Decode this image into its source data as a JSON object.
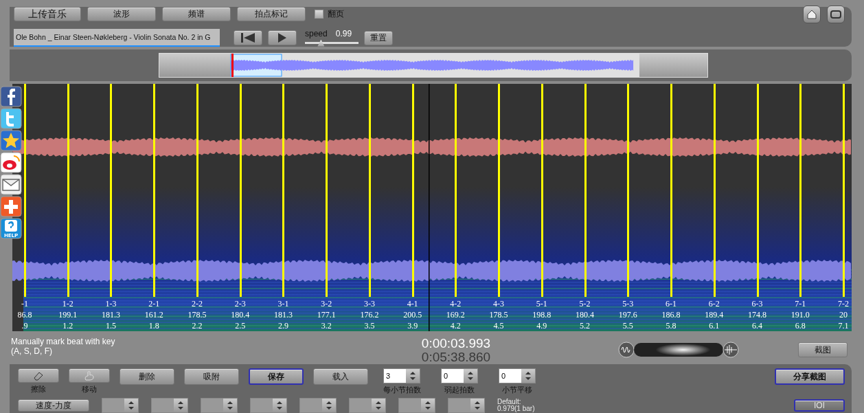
{
  "toolbar": {
    "upload_button": "上传音乐",
    "view_buttons": [
      "波形",
      "频谱",
      "拍点标记"
    ],
    "page_flip": {
      "label": "翻页",
      "checked": false
    }
  },
  "file_name": "Ole Bohn _ Einar Steen-Nøkleberg - Violin Sonata No. 2 in G",
  "speed": {
    "label": "speed",
    "value": "0.99",
    "level": 0.3
  },
  "reset_button": "重置",
  "social": [
    {
      "kind": "facebook"
    },
    {
      "kind": "twitter"
    },
    {
      "kind": "star"
    },
    {
      "kind": "weibo"
    },
    {
      "kind": "mail"
    },
    {
      "kind": "plus"
    },
    {
      "kind": "help",
      "label": "HELP"
    }
  ],
  "beats": [
    {
      "label": "-1",
      "tempo": "86.8",
      "time": ".9"
    },
    {
      "label": "1-2",
      "tempo": "199.1",
      "time": "1.2"
    },
    {
      "label": "1-3",
      "tempo": "181.3",
      "time": "1.5"
    },
    {
      "label": "2-1",
      "tempo": "161.2",
      "time": "1.8"
    },
    {
      "label": "2-2",
      "tempo": "178.5",
      "time": "2.2"
    },
    {
      "label": "2-3",
      "tempo": "180.4",
      "time": "2.5"
    },
    {
      "label": "3-1",
      "tempo": "181.3",
      "time": "2.9"
    },
    {
      "label": "3-2",
      "tempo": "177.1",
      "time": "3.2"
    },
    {
      "label": "3-3",
      "tempo": "176.2",
      "time": "3.5"
    },
    {
      "label": "4-1",
      "tempo": "200.5",
      "time": "3.9"
    },
    {
      "label": "4-2",
      "tempo": "169.2",
      "time": "4.2"
    },
    {
      "label": "4-3",
      "tempo": "178.5",
      "time": "4.5"
    },
    {
      "label": "5-1",
      "tempo": "198.8",
      "time": "4.9"
    },
    {
      "label": "5-2",
      "tempo": "180.4",
      "time": "5.2"
    },
    {
      "label": "5-3",
      "tempo": "197.6",
      "time": "5.5"
    },
    {
      "label": "6-1",
      "tempo": "186.8",
      "time": "5.8"
    },
    {
      "label": "6-2",
      "tempo": "189.4",
      "time": "6.1"
    },
    {
      "label": "6-3",
      "tempo": "174.8",
      "time": "6.4"
    },
    {
      "label": "7-1",
      "tempo": "191.0",
      "time": "6.8"
    },
    {
      "label": "7-2",
      "tempo": "20",
      "time": "7.1"
    }
  ],
  "hint_lines": [
    "Manually mark beat with key",
    "(A, S, D, F)"
  ],
  "current_time": "0:00:03.993",
  "total_time": "0:05:38.860",
  "blend": {
    "level": 0.55
  },
  "screenshot_button": "截图",
  "edit_tools": [
    {
      "kind": "eraser",
      "label": "擦除"
    },
    {
      "kind": "move",
      "label": "移动"
    }
  ],
  "actions": [
    {
      "label": "删除",
      "selected": false
    },
    {
      "label": "吸附",
      "selected": false
    },
    {
      "label": "保存",
      "selected": true
    },
    {
      "label": "载入",
      "selected": false
    }
  ],
  "spinners": [
    {
      "value": "3",
      "label": "每小节拍数"
    },
    {
      "value": "0",
      "label": "弱起拍数"
    },
    {
      "value": "0",
      "label": "小节平移"
    }
  ],
  "share_button": "分享截图",
  "tempo_button": "速度-力度",
  "default_note": [
    "Default:",
    "0.979(1 bar)"
  ],
  "ioi_button": {
    "label": "IOI",
    "disabled": true
  }
}
